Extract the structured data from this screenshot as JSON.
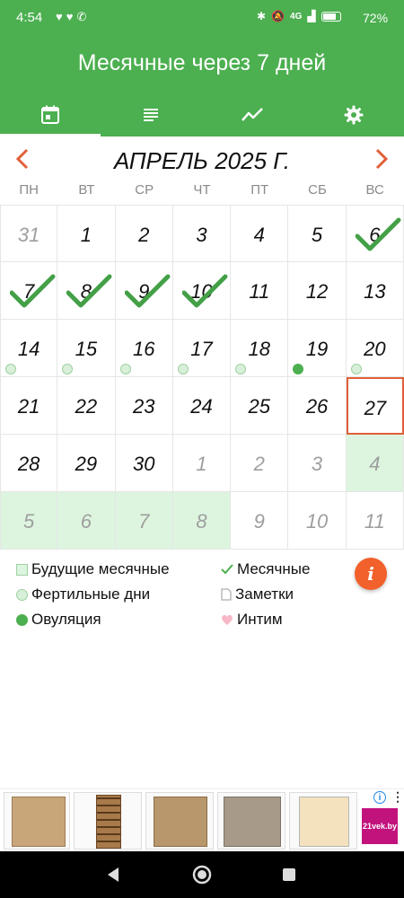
{
  "status_bar": {
    "time": "4:54",
    "network": "4G",
    "battery_percent": "72"
  },
  "app": {
    "title": "Месячные через 7 дней",
    "tabs": [
      {
        "icon": "calendar-icon",
        "selected": true
      },
      {
        "icon": "list-icon",
        "selected": false
      },
      {
        "icon": "chart-icon",
        "selected": false
      },
      {
        "icon": "gear-icon",
        "selected": false
      }
    ]
  },
  "calendar": {
    "month_title": "АПРЕЛЬ 2025 Г.",
    "weekdays": [
      "ПН",
      "ВТ",
      "СР",
      "ЧТ",
      "ПТ",
      "СБ",
      "ВС"
    ],
    "weeks": [
      [
        {
          "d": "31",
          "other": true
        },
        {
          "d": "1"
        },
        {
          "d": "2"
        },
        {
          "d": "3"
        },
        {
          "d": "4"
        },
        {
          "d": "5"
        },
        {
          "d": "6",
          "check": true
        }
      ],
      [
        {
          "d": "7",
          "check": true
        },
        {
          "d": "8",
          "check": true
        },
        {
          "d": "9",
          "check": true
        },
        {
          "d": "10",
          "check": true
        },
        {
          "d": "11"
        },
        {
          "d": "12"
        },
        {
          "d": "13"
        }
      ],
      [
        {
          "d": "14",
          "dot": "fertile"
        },
        {
          "d": "15",
          "dot": "fertile"
        },
        {
          "d": "16",
          "dot": "fertile"
        },
        {
          "d": "17",
          "dot": "fertile"
        },
        {
          "d": "18",
          "dot": "fertile"
        },
        {
          "d": "19",
          "dot": "ovulation"
        },
        {
          "d": "20",
          "dot": "fertile"
        }
      ],
      [
        {
          "d": "21"
        },
        {
          "d": "22"
        },
        {
          "d": "23"
        },
        {
          "d": "24"
        },
        {
          "d": "25"
        },
        {
          "d": "26"
        },
        {
          "d": "27",
          "today": true
        }
      ],
      [
        {
          "d": "28"
        },
        {
          "d": "29"
        },
        {
          "d": "30"
        },
        {
          "d": "1",
          "other": true
        },
        {
          "d": "2",
          "other": true
        },
        {
          "d": "3",
          "other": true
        },
        {
          "d": "4",
          "other": true,
          "future": true
        }
      ],
      [
        {
          "d": "5",
          "other": true,
          "future": true
        },
        {
          "d": "6",
          "other": true,
          "future": true
        },
        {
          "d": "7",
          "other": true,
          "future": true
        },
        {
          "d": "8",
          "other": true,
          "future": true
        },
        {
          "d": "9",
          "other": true
        },
        {
          "d": "10",
          "other": true
        },
        {
          "d": "11",
          "other": true
        }
      ]
    ]
  },
  "legend": {
    "future_periods": "Будущие месячные",
    "fertile_days": "Фертильные дни",
    "ovulation": "Овуляция",
    "periods": "Месячные",
    "notes": "Заметки",
    "intimacy": "Интим",
    "info_label": "i"
  },
  "ad": {
    "brand": "21vek.by"
  },
  "colors": {
    "primary_green": "#4caf50",
    "future_fill": "#ddf5df",
    "today_border": "#e0603a",
    "accent_orange": "#f2602b",
    "intimacy_pink": "#f6b8c4"
  }
}
